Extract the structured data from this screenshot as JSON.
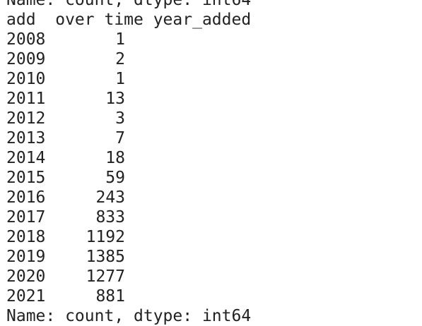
{
  "output": {
    "top_clipped_line": "Name: count, dtype: int64",
    "header": "add  over time year_added",
    "rows": [
      {
        "year": "2008",
        "count": "1"
      },
      {
        "year": "2009",
        "count": "2"
      },
      {
        "year": "2010",
        "count": "1"
      },
      {
        "year": "2011",
        "count": "13"
      },
      {
        "year": "2012",
        "count": "3"
      },
      {
        "year": "2013",
        "count": "7"
      },
      {
        "year": "2014",
        "count": "18"
      },
      {
        "year": "2015",
        "count": "59"
      },
      {
        "year": "2016",
        "count": "243"
      },
      {
        "year": "2017",
        "count": "833"
      },
      {
        "year": "2018",
        "count": "1192"
      },
      {
        "year": "2019",
        "count": "1385"
      },
      {
        "year": "2020",
        "count": "1277"
      },
      {
        "year": "2021",
        "count": "881"
      }
    ],
    "bottom_clipped_line": "Name: count, dtype: int64"
  }
}
